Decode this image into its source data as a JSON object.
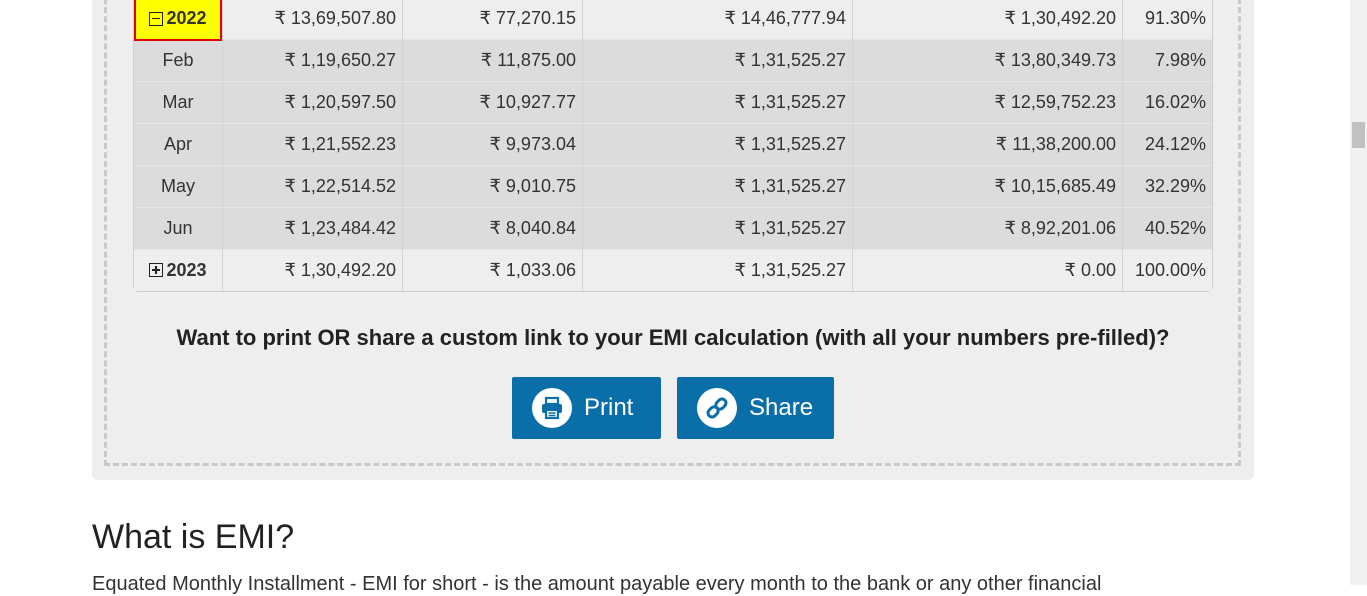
{
  "table": {
    "year_row_2022": {
      "year": "2022",
      "principal": "₹ 13,69,507.80",
      "interest": "₹ 77,270.15",
      "total_payment": "₹ 14,46,777.94",
      "balance": "₹ 1,30,492.20",
      "loan_paid": "91.30%"
    },
    "months": [
      {
        "month": "Feb",
        "principal": "₹ 1,19,650.27",
        "interest": "₹ 11,875.00",
        "total_payment": "₹ 1,31,525.27",
        "balance": "₹ 13,80,349.73",
        "loan_paid": "7.98%"
      },
      {
        "month": "Mar",
        "principal": "₹ 1,20,597.50",
        "interest": "₹ 10,927.77",
        "total_payment": "₹ 1,31,525.27",
        "balance": "₹ 12,59,752.23",
        "loan_paid": "16.02%"
      },
      {
        "month": "Apr",
        "principal": "₹ 1,21,552.23",
        "interest": "₹ 9,973.04",
        "total_payment": "₹ 1,31,525.27",
        "balance": "₹ 11,38,200.00",
        "loan_paid": "24.12%"
      },
      {
        "month": "May",
        "principal": "₹ 1,22,514.52",
        "interest": "₹ 9,010.75",
        "total_payment": "₹ 1,31,525.27",
        "balance": "₹ 10,15,685.49",
        "loan_paid": "32.29%"
      },
      {
        "month": "Jun",
        "principal": "₹ 1,23,484.42",
        "interest": "₹ 8,040.84",
        "total_payment": "₹ 1,31,525.27",
        "balance": "₹ 8,92,201.06",
        "loan_paid": "40.52%"
      }
    ],
    "year_row_2023": {
      "year": "2023",
      "principal": "₹ 1,30,492.20",
      "interest": "₹ 1,033.06",
      "total_payment": "₹ 1,31,525.27",
      "balance": "₹ 0.00",
      "loan_paid": "100.00%"
    }
  },
  "share_section": {
    "prompt": "Want to print OR share a custom link to your EMI calculation (with all your numbers pre-filled)?",
    "print_label": "Print",
    "share_label": "Share"
  },
  "article": {
    "heading": "What is EMI?",
    "intro_cut": "Equated Monthly Installment - EMI for short - is the amount payable every month to the bank or any other financial"
  },
  "icons": {
    "collapse": "minus-square-icon",
    "expand": "plus-square-icon",
    "print": "printer-icon",
    "share": "link-icon"
  },
  "colors": {
    "button_bg": "#0a6fa8",
    "highlight_bg": "#ffff00",
    "highlight_border": "#e00000"
  }
}
